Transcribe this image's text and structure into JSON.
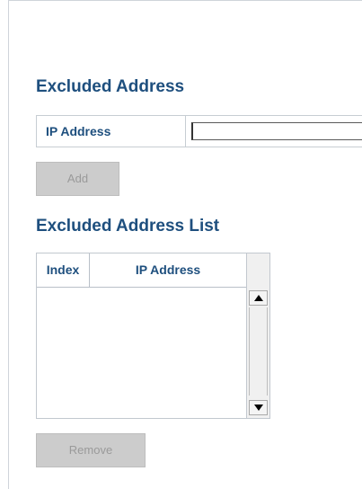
{
  "excluded": {
    "title": "Excluded Address",
    "ip_label": "IP Address",
    "ip_value": "",
    "add_label": "Add"
  },
  "list": {
    "title": "Excluded Address List",
    "columns": [
      "Index",
      "IP Address"
    ],
    "rows": [],
    "remove_label": "Remove"
  },
  "icons": {
    "scroll_up": "triangle-up-icon",
    "scroll_down": "triangle-down-icon"
  },
  "colors": {
    "title": "#1e4f7e",
    "button_disabled_bg": "#cccccc",
    "button_disabled_text": "#9a9a9a"
  }
}
